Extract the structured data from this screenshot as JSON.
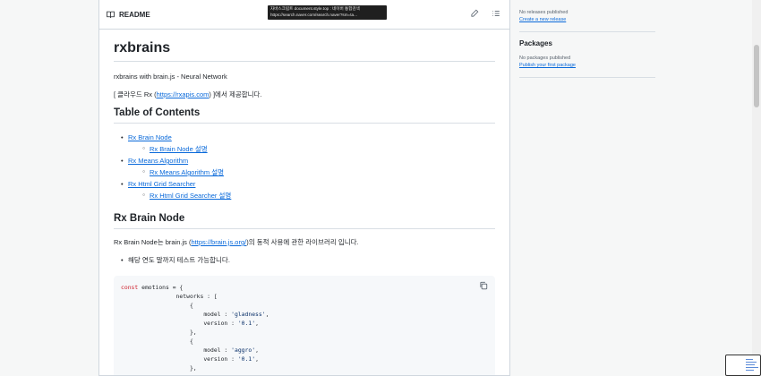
{
  "readme": {
    "label": "README",
    "tooltip_line1": "자바스크립트 document.style.top : 네이버 통합검색",
    "tooltip_line2": "https://search.naver.com/search.naver?sm=ta..."
  },
  "content": {
    "title": "rxbrains",
    "subtitle": "rxbrains with brain.js - Neural Network",
    "provided_prefix": "[ 클라우드 Rx (",
    "provided_link": "https://rxapis.com",
    "provided_suffix": ") ]에서 제공합니다.",
    "toc_heading": "Table of Contents",
    "toc": [
      {
        "label": "Rx Brain Node",
        "sub": "Rx Brain Node 설명"
      },
      {
        "label": "Rx Means Algorithm",
        "sub": "Rx Means Algorithm 설명"
      },
      {
        "label": "Rx Html Grid Searcher",
        "sub": "Rx Html Grid Searcher 설명"
      }
    ],
    "section_heading": "Rx Brain Node",
    "section_prefix": "Rx Brain Node는 brain.js (",
    "section_link": "https://brain.js.org/",
    "section_suffix": ")의 동적 사용에 관한 라이브러리 입니다.",
    "bullet": "해당 연도 말까지 테스트 가능합니다.",
    "code": {
      "l1_kw": "const",
      "l1_rest": " emotions = {",
      "l2": "                networks : [",
      "l3": "                    {",
      "l4_key": "                        model : ",
      "l4_val": "'gladness'",
      "l5_key": "                        version : ",
      "l5_val": "'0.1'",
      "l6": "                    },",
      "l7": "                    {",
      "l8_key": "                        model : ",
      "l8_val": "'aggro'",
      "l9_key": "                        version : ",
      "l9_val": "'0.1'",
      "l10": "                    },"
    }
  },
  "sidebar": {
    "releases_text": "No releases published",
    "releases_link": "Create a new release",
    "packages_heading": "Packages",
    "packages_text": "No packages published",
    "packages_link": "Publish your first package"
  }
}
